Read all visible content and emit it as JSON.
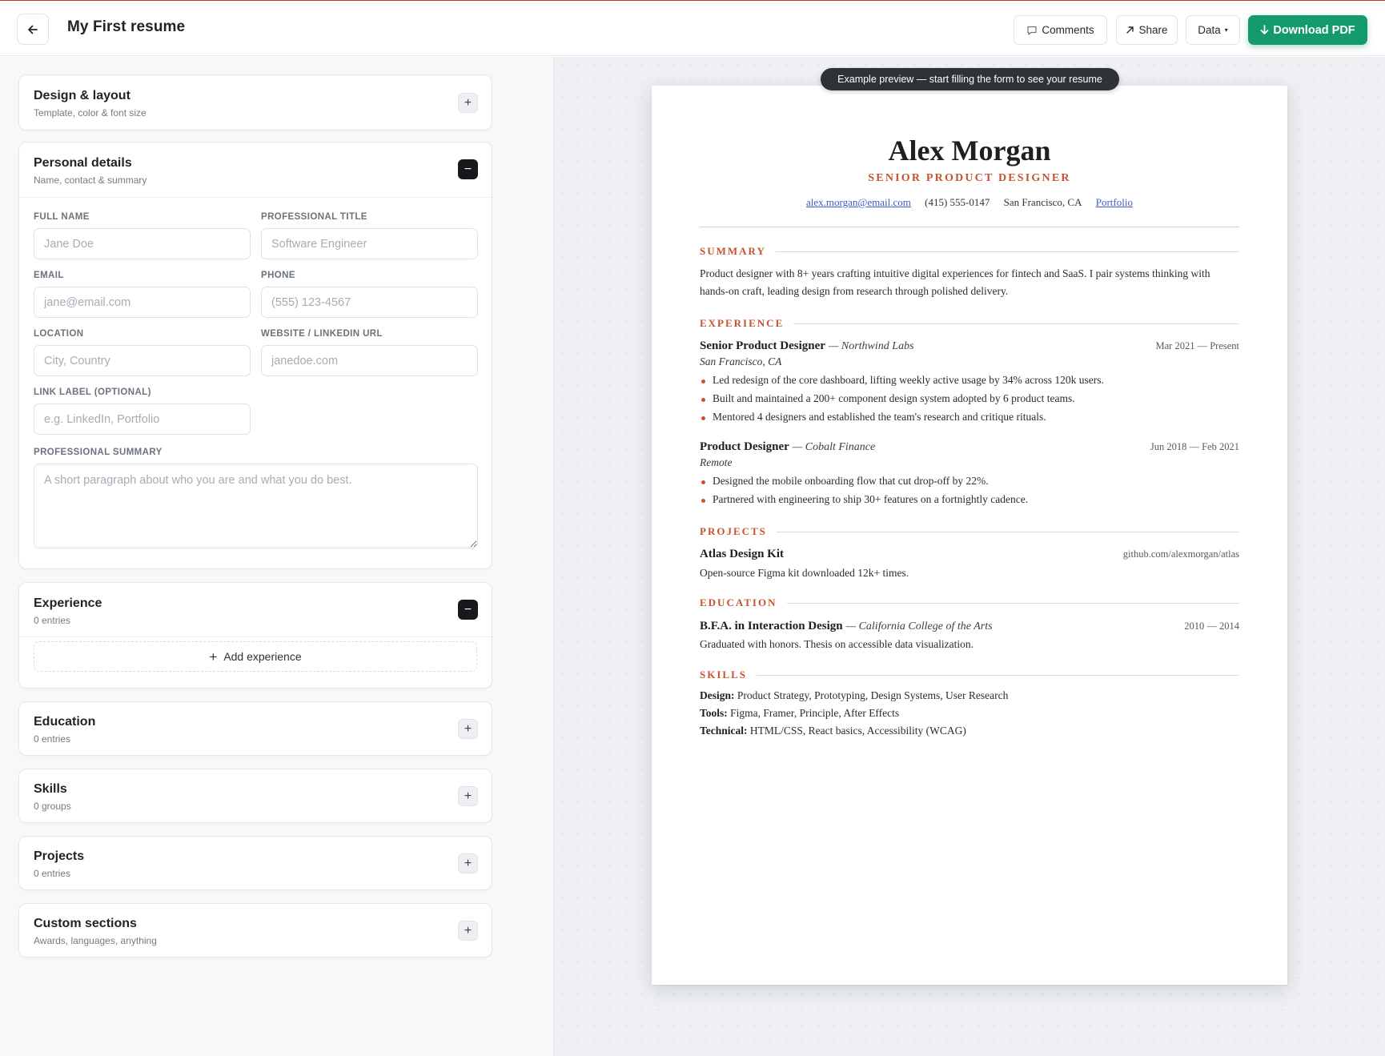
{
  "topbar": {
    "doc_title": "My First  resume",
    "comments_label": "Comments",
    "share_label": "Share",
    "data_label": "Data",
    "download_label": "Download PDF",
    "accent_color": "#159a6c"
  },
  "sections": {
    "design": {
      "title": "Design & layout",
      "sub": "Template, color & font size"
    },
    "personal": {
      "title": "Personal details",
      "sub": "Name, contact & summary",
      "fields": {
        "full_name": {
          "label": "Full name",
          "placeholder": "Jane Doe",
          "value": ""
        },
        "title": {
          "label": "Professional title",
          "placeholder": "Software Engineer",
          "value": ""
        },
        "email": {
          "label": "Email",
          "placeholder": "jane@email.com",
          "value": ""
        },
        "phone": {
          "label": "Phone",
          "placeholder": "(555) 123-4567",
          "value": ""
        },
        "location": {
          "label": "Location",
          "placeholder": "City, Country",
          "value": ""
        },
        "website": {
          "label": "Website / LinkedIn URL",
          "placeholder": "janedoe.com",
          "value": ""
        },
        "link_label": {
          "label": "Link label (optional)",
          "placeholder": "e.g. LinkedIn, Portfolio",
          "value": ""
        },
        "summary": {
          "label": "Professional summary",
          "placeholder": "A short paragraph about who you are and what you do best.",
          "value": ""
        }
      }
    },
    "experience": {
      "title": "Experience",
      "sub": "0 entries",
      "add_label": "Add experience"
    },
    "education": {
      "title": "Education",
      "sub": "0 entries"
    },
    "skills": {
      "title": "Skills",
      "sub": "0 groups"
    },
    "projects": {
      "title": "Projects",
      "sub": "0 entries"
    },
    "custom": {
      "title": "Custom sections",
      "sub": "Awards, languages, anything"
    }
  },
  "preview": {
    "banner": "Example preview — start filling the form to see your resume",
    "name": "Alex Morgan",
    "role": "SENIOR PRODUCT DESIGNER",
    "email": "alex.morgan@email.com",
    "phone": "(415) 555-0147",
    "location": "San Francisco, CA",
    "portfolio": "Portfolio",
    "summary_heading": "SUMMARY",
    "summary": "Product designer with 8+ years crafting intuitive digital experiences for fintech and SaaS. I pair systems thinking with hands-on craft, leading design from research through polished delivery.",
    "experience_heading": "EXPERIENCE",
    "jobs": [
      {
        "title": "Senior Product Designer",
        "company": "— Northwind Labs",
        "dates": "Mar 2021 — Present",
        "location": "San Francisco, CA",
        "bullets": [
          "Led redesign of the core dashboard, lifting weekly active usage by 34% across 120k users.",
          "Built and maintained a 200+ component design system adopted by 6 product teams.",
          "Mentored 4 designers and established the team's research and critique rituals."
        ]
      },
      {
        "title": "Product Designer",
        "company": "— Cobalt Finance",
        "dates": "Jun 2018 — Feb 2021",
        "location": "Remote",
        "bullets": [
          "Designed the mobile onboarding flow that cut drop-off by 22%.",
          "Partnered with engineering to ship 30+ features on a fortnightly cadence."
        ]
      }
    ],
    "projects_heading": "PROJECTS",
    "project": {
      "name": "Atlas Design Kit",
      "url": "github.com/alexmorgan/atlas",
      "desc": "Open-source Figma kit downloaded 12k+ times."
    },
    "education_heading": "EDUCATION",
    "education": {
      "degree": "B.F.A. in Interaction Design",
      "school": "— California College of the Arts",
      "dates": "2010 — 2014",
      "desc": "Graduated with honors. Thesis on accessible data visualization."
    },
    "skills_heading": "SKILLS",
    "skills": [
      {
        "label": "Design:",
        "items": "Product Strategy, Prototyping, Design Systems, User Research"
      },
      {
        "label": "Tools:",
        "items": "Figma, Framer, Principle, After Effects"
      },
      {
        "label": "Technical:",
        "items": "HTML/CSS, React basics, Accessibility (WCAG)"
      }
    ],
    "accent_color": "#c5532f",
    "link_color": "#3b5bc9"
  }
}
